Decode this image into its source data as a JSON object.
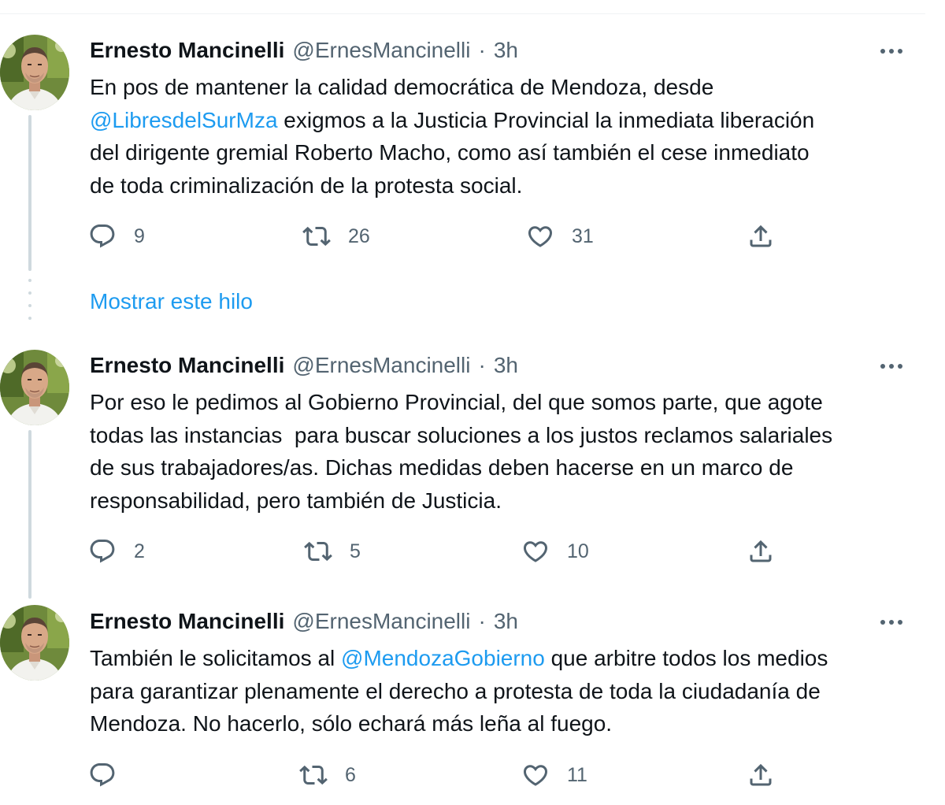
{
  "tweets": [
    {
      "author": {
        "name": "Ernesto Mancinelli",
        "handle": "@ErnesMancinelli"
      },
      "separator": "·",
      "time": "3h",
      "text": {
        "l1": "En pos de mantener la calidad democrática de Mendoza, desde",
        "l2_mention": "@LibresdelSurMza",
        "l2_rest": " exigmos a la Justicia Provincial la inmediata liberación",
        "l3": "del dirigente gremial Roberto Macho, como así también el cese inmediato",
        "l4": "de toda criminalización de la protesta social."
      },
      "replies": "9",
      "retweets": "26",
      "likes": "31"
    },
    {
      "author": {
        "name": "Ernesto Mancinelli",
        "handle": "@ErnesMancinelli"
      },
      "separator": "·",
      "time": "3h",
      "text": {
        "l1": "Por eso le pedimos al Gobierno Provincial, del que somos parte, que agote",
        "l2": "todas las instancias  para buscar soluciones a los justos reclamos salariales",
        "l3": "de sus trabajadores/as. Dichas medidas deben hacerse en un marco de",
        "l4": "responsabilidad, pero también de Justicia."
      },
      "replies": "2",
      "retweets": "5",
      "likes": "10"
    },
    {
      "author": {
        "name": "Ernesto Mancinelli",
        "handle": "@ErnesMancinelli"
      },
      "separator": "·",
      "time": "3h",
      "text": {
        "l1_pre": "También le solicitamos al ",
        "l1_mention": "@MendozaGobierno",
        "l1_post": " que arbitre todos los medios",
        "l2": "para garantizar plenamente el derecho a protesta de toda la ciudadanía de",
        "l3": "Mendoza. No hacerlo, sólo echará más leña al fuego."
      },
      "replies": "",
      "retweets": "6",
      "likes": "11"
    }
  ],
  "show_thread": "Mostrar este hilo",
  "icons": {
    "reply": "reply-icon",
    "retweet": "retweet-icon",
    "like": "heart-icon",
    "share": "share-icon",
    "more": "more-icon"
  },
  "colors": {
    "text": "#0f1419",
    "secondary": "#536471",
    "link": "#1d9bf0",
    "thread_line": "#cfd9de"
  }
}
